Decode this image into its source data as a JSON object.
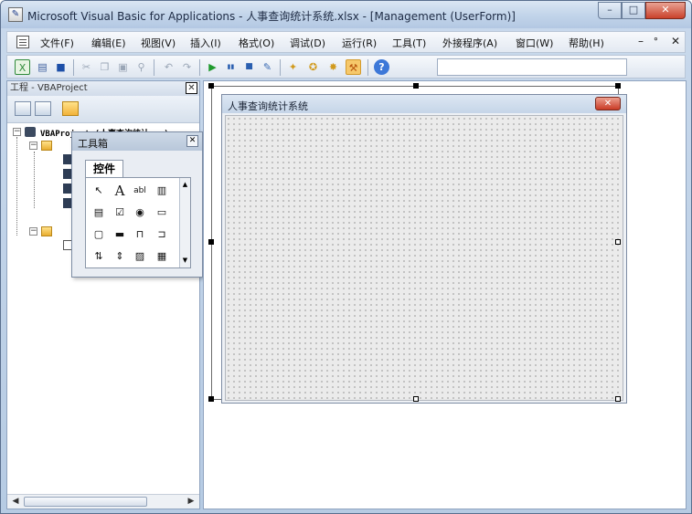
{
  "window": {
    "title": "Microsoft Visual Basic for Applications - 人事查询统计系统.xlsx - [Management (UserForm)]",
    "min_label": "–",
    "max_label": "□",
    "close_label": "✕"
  },
  "menubar": {
    "items": [
      {
        "label": "文件(F)"
      },
      {
        "label": "编辑(E)"
      },
      {
        "label": "视图(V)"
      },
      {
        "label": "插入(I)"
      },
      {
        "label": "格式(O)"
      },
      {
        "label": "调试(D)"
      },
      {
        "label": "运行(R)"
      },
      {
        "label": "工具(T)"
      },
      {
        "label": "外接程序(A)"
      },
      {
        "label": "窗口(W)"
      },
      {
        "label": "帮助(H)"
      }
    ],
    "mdi_min": "–",
    "mdi_restore": "ᐤ",
    "mdi_close": "✕"
  },
  "toolbar": {
    "buttons": [
      {
        "icon": "excel-icon",
        "glyph": "X",
        "color": "#2f8a3a"
      },
      {
        "icon": "insert-userform-icon",
        "glyph": "▤",
        "color": "#3d5f9e"
      },
      {
        "icon": "save-icon",
        "glyph": "■",
        "color": "#1d4fa8"
      },
      {
        "icon": "cut-icon",
        "glyph": "✂",
        "color": "#9aa6b6"
      },
      {
        "icon": "copy-icon",
        "glyph": "❐",
        "color": "#9aa6b6"
      },
      {
        "icon": "paste-icon",
        "glyph": "▣",
        "color": "#9aa6b6"
      },
      {
        "icon": "find-icon",
        "glyph": "⚲",
        "color": "#9aa6b6"
      },
      {
        "icon": "undo-icon",
        "glyph": "↶",
        "color": "#9aa6b6"
      },
      {
        "icon": "redo-icon",
        "glyph": "↷",
        "color": "#9aa6b6"
      },
      {
        "icon": "run-icon",
        "glyph": "▶",
        "color": "#1f9a2d"
      },
      {
        "icon": "break-icon",
        "glyph": "▮▮",
        "color": "#2a5fb0"
      },
      {
        "icon": "reset-icon",
        "glyph": "■",
        "color": "#2a5fb0"
      },
      {
        "icon": "design-mode-icon",
        "glyph": "✎",
        "color": "#3b6bb3"
      },
      {
        "icon": "project-explorer-icon",
        "glyph": "✦",
        "color": "#d19a1d"
      },
      {
        "icon": "properties-icon",
        "glyph": "✪",
        "color": "#d19a1d"
      },
      {
        "icon": "object-browser-icon",
        "glyph": "✸",
        "color": "#d19a1d"
      },
      {
        "icon": "toolbox-icon",
        "glyph": "⚒",
        "color": "#b8560e"
      },
      {
        "icon": "help-icon",
        "glyph": "?",
        "color": "#1d5fc8"
      }
    ]
  },
  "project": {
    "title": "工程 - VBAProject",
    "close_label": "✕",
    "root_label": "VBAProject (人事查询统计...)"
  },
  "toolbox": {
    "title": "工具箱",
    "tab_label": "控件",
    "close_label": "✕",
    "controls": [
      {
        "name": "select-objects-icon",
        "glyph": "↖"
      },
      {
        "name": "label-tool-icon",
        "glyph": "A"
      },
      {
        "name": "textbox-tool-icon",
        "glyph": "abl"
      },
      {
        "name": "combobox-tool-icon",
        "glyph": "▥"
      },
      {
        "name": "listbox-tool-icon",
        "glyph": "▤"
      },
      {
        "name": "checkbox-tool-icon",
        "glyph": "☑"
      },
      {
        "name": "optionbutton-tool-icon",
        "glyph": "◉"
      },
      {
        "name": "togglebutton-tool-icon",
        "glyph": "▭"
      },
      {
        "name": "frame-tool-icon",
        "glyph": "▢"
      },
      {
        "name": "commandbutton-tool-icon",
        "glyph": "▬"
      },
      {
        "name": "tabstrip-tool-icon",
        "glyph": "⊓"
      },
      {
        "name": "multipage-tool-icon",
        "glyph": "⊐"
      },
      {
        "name": "scrollbar-tool-icon",
        "glyph": "⇅"
      },
      {
        "name": "spinbutton-tool-icon",
        "glyph": "⇕"
      },
      {
        "name": "image-tool-icon",
        "glyph": "▨"
      },
      {
        "name": "refedit-tool-icon",
        "glyph": "▦"
      }
    ],
    "scroll_up": "▲",
    "scroll_down": "▼"
  },
  "form": {
    "title": "人事查询统计系统",
    "close_label": "✕"
  },
  "scroll": {
    "left": "◀",
    "right": "▶",
    "grip": "⁞"
  }
}
